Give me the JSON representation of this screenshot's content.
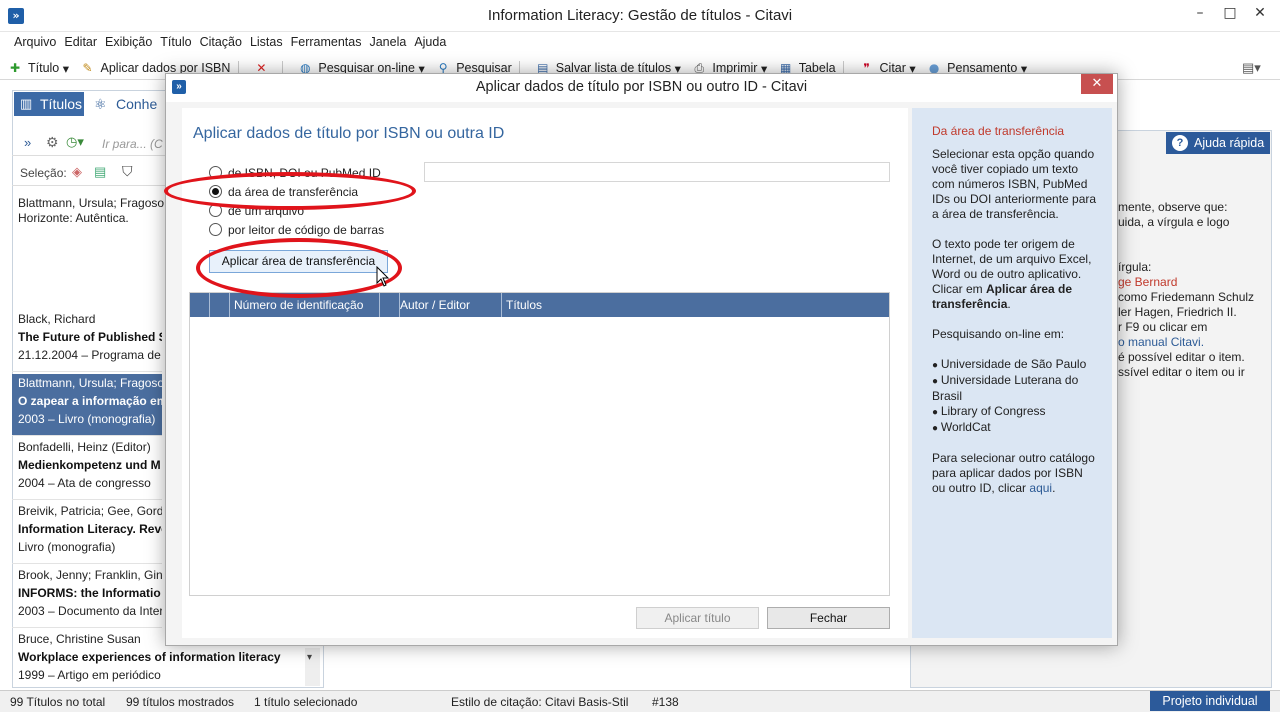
{
  "window": {
    "title": "Information Literacy: Gestão de títulos - Citavi",
    "min": "–",
    "max": "□",
    "close": "✕"
  },
  "menu": [
    "Arquivo",
    "Editar",
    "Exibição",
    "Título",
    "Citação",
    "Listas",
    "Ferramentas",
    "Janela",
    "Ajuda"
  ],
  "toolbar": {
    "titulo": "Título",
    "aplicar": "Aplicar dados por ISBN",
    "pesquisar_online": "Pesquisar on-line",
    "pesquisar": "Pesquisar",
    "salvar": "Salvar lista de títulos",
    "imprimir": "Imprimir",
    "tabela": "Tabela",
    "citar": "Citar",
    "pensamento": "Pensamento"
  },
  "left": {
    "tab_titulos": "Títulos",
    "tab_conhe": "Conhe",
    "search_placeholder": "Ir para... (C",
    "selecao": "Seleção:",
    "preview": "Blattmann, Ursula; Fragoso zapear a informação em bil Horizonte: Autêntica.",
    "items": [
      {
        "author": "Black, Richard",
        "title": "The Future of Published Sc",
        "meta": "21.12.2004 – Programa de"
      },
      {
        "author": "Blattmann, Ursula; Fragoso,",
        "title": "O zapear a informação em",
        "meta": "2003 – Livro (monografia)"
      },
      {
        "author": "Bonfadelli, Heinz (Editor)",
        "title": "Medienkompetenz und M",
        "meta": "2004 – Ata de congresso"
      },
      {
        "author": "Breivik, Patricia; Gee, Gordo",
        "title": "Information Literacy. Revo",
        "meta": "Livro (monografia)"
      },
      {
        "author": "Brook, Jenny; Franklin, Ginn",
        "title": "INFORMS: the Informatio",
        "meta": "2003 – Documento da Inter"
      },
      {
        "author": "Bruce, Christine Susan",
        "title": "Workplace experiences of information literacy",
        "meta": "1999 – Artigo em periódico"
      }
    ]
  },
  "right": {
    "ajuda": "Ajuda rápida",
    "lines": [
      "mente, observe que:",
      "uida, a vírgula e logo",
      "",
      "",
      "írgula:",
      "ge Bernard",
      "como Friedemann Schulz",
      "ler Hagen, Friedrich II.",
      "r F9 ou clicar em",
      "o manual Citavi.",
      "é possível editar o item.",
      "ssível editar o item ou ir"
    ]
  },
  "status": {
    "total": "99 Títulos no total",
    "mostrados": "99 títulos mostrados",
    "selecionado": "1 título selecionado",
    "estilo": "Estilo de citação: Citavi Basis-Stil",
    "num": "#138",
    "projeto": "Projeto individual"
  },
  "dialog": {
    "title": "Aplicar dados de título por ISBN ou outro ID - Citavi",
    "close": "✕",
    "heading": "Aplicar dados de título por ISBN ou outra ID",
    "options": [
      "de ISBN, DOI ou PubMed ID",
      "da área de transferência",
      "de um arquivo",
      "por leitor de código de barras"
    ],
    "apply_clipboard": "Aplicar área de transferência",
    "columns": [
      "Número de identificação",
      "Autor / Editor",
      "Títulos"
    ],
    "btn_aplicar": "Aplicar título",
    "btn_fechar": "Fechar",
    "help": {
      "title": "Da área de transferência",
      "p1": "Selecionar esta opção quando você tiver copiado um texto com números ISBN, PubMed IDs ou DOI anteriormente para a área de transferência.",
      "p2a": "O texto pode ter origem de Internet, de um arquivo Excel, Word ou de outro aplicativo. Clicar em ",
      "p2b": "Aplicar área de transferência",
      "p2c": ".",
      "p3": "Pesquisando on-line em:",
      "catalogs": [
        "Universidade de São Paulo",
        "Universidade Luterana do Brasil",
        "Library of Congress",
        "WorldCat"
      ],
      "p4": "Para selecionar outro catálogo para aplicar dados por ISBN ou outro ID, clicar",
      "link": "aqui",
      "p4end": "."
    }
  },
  "colors": {
    "accent": "#2c5a9a",
    "selection": "#4b6e9f",
    "annotation": "#e0141b"
  }
}
